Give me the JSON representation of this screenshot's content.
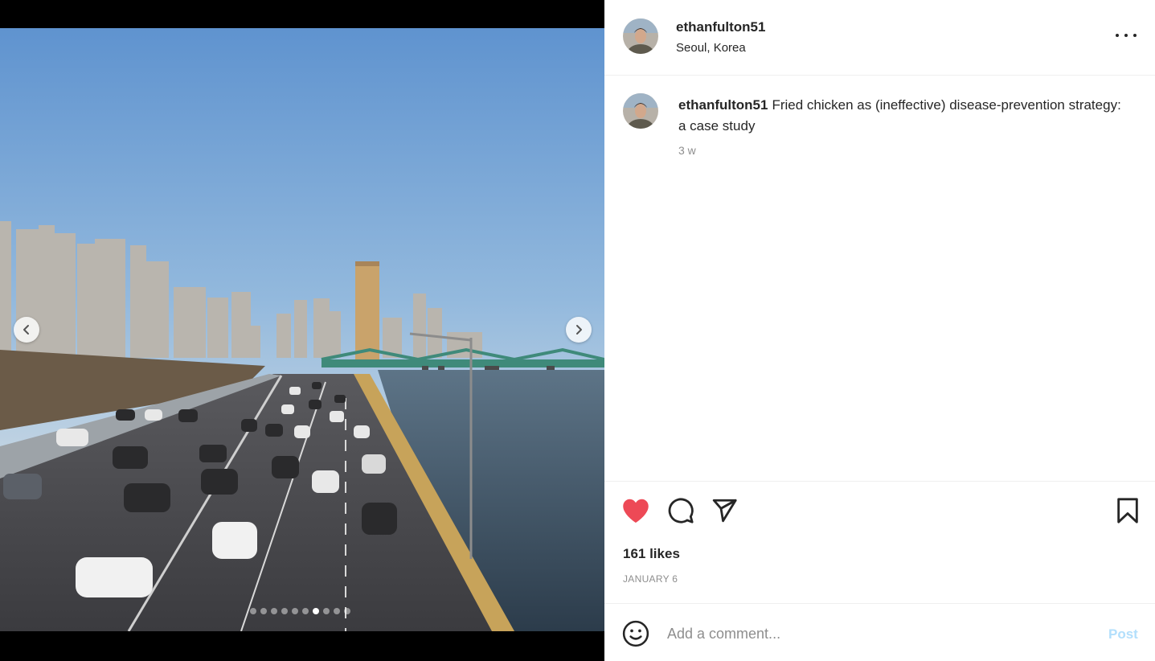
{
  "post": {
    "username": "ethanfulton51",
    "location": "Seoul, Korea",
    "caption": "Fried chicken as (ineffective) disease-prevention strategy: a case study",
    "time_ago": "3 w",
    "likes": "161 likes",
    "date": "JANUARY 6"
  },
  "carousel": {
    "total_images": 10,
    "current_index": 7,
    "prev_icon": "chevron-left-icon",
    "next_icon": "chevron-right-icon"
  },
  "actions": {
    "like_icon": "heart-filled-icon",
    "comment_icon": "comment-bubble-icon",
    "share_icon": "paper-plane-icon",
    "save_icon": "bookmark-icon",
    "liked_color": "#ed4956"
  },
  "add_comment": {
    "emoji_icon": "smiley-icon",
    "placeholder": "Add a comment...",
    "post_label": "Post",
    "post_color": "#b2dffc"
  }
}
